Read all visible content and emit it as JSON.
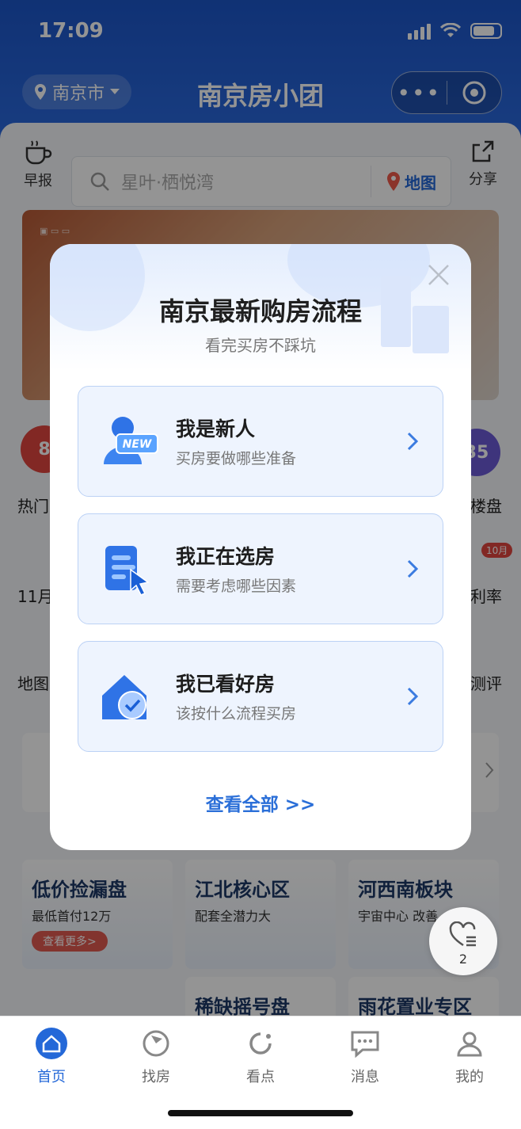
{
  "status_bar": {
    "time": "17:09"
  },
  "nav": {
    "city": "南京市",
    "title": "南京房小团"
  },
  "toolbar": {
    "left_label": "早报",
    "search_placeholder": "星叶·栖悦湾",
    "map_label": "地图",
    "share_label": "分享"
  },
  "background_fragments": {
    "hot_label": "热门",
    "hot_num": "8",
    "loupan_label": "楼盘",
    "loupan_num": "35",
    "nov_label": "11月",
    "rate_label": "利率",
    "rate_badge": "10月",
    "map_label": "地图",
    "eval_label": "测评"
  },
  "promos": [
    {
      "title": "低价捡漏盘",
      "sub": "最低首付12万",
      "btn": "查看更多>"
    },
    {
      "title": "江北核心区",
      "sub": "配套全潜力大"
    },
    {
      "title": "河西南板块",
      "sub": "宇宙中心 改善"
    }
  ],
  "promos_row2": [
    "稀缺摇号盘",
    "雨花置业专区"
  ],
  "favorite": {
    "count": "2"
  },
  "modal": {
    "title": "南京最新购房流程",
    "subtitle": "看完买房不踩坑",
    "options": [
      {
        "title": "我是新人",
        "sub": "买房要做哪些准备",
        "icon": "new-user-icon",
        "badge": "NEW"
      },
      {
        "title": "我正在选房",
        "sub": "需要考虑哪些因素",
        "icon": "select-house-icon"
      },
      {
        "title": "我已看好房",
        "sub": "该按什么流程买房",
        "icon": "house-check-icon"
      }
    ],
    "view_all": "查看全部 >>"
  },
  "tabbar": [
    {
      "label": "首页",
      "icon": "home-icon",
      "active": true
    },
    {
      "label": "找房",
      "icon": "find-house-icon",
      "active": false
    },
    {
      "label": "看点",
      "icon": "highlights-icon",
      "active": false
    },
    {
      "label": "消息",
      "icon": "message-icon",
      "active": false
    },
    {
      "label": "我的",
      "icon": "profile-icon",
      "active": false
    }
  ],
  "colors": {
    "accent": "#2468d8",
    "header": "#1c56c9",
    "modal_option_bg": "#eef4fe"
  }
}
